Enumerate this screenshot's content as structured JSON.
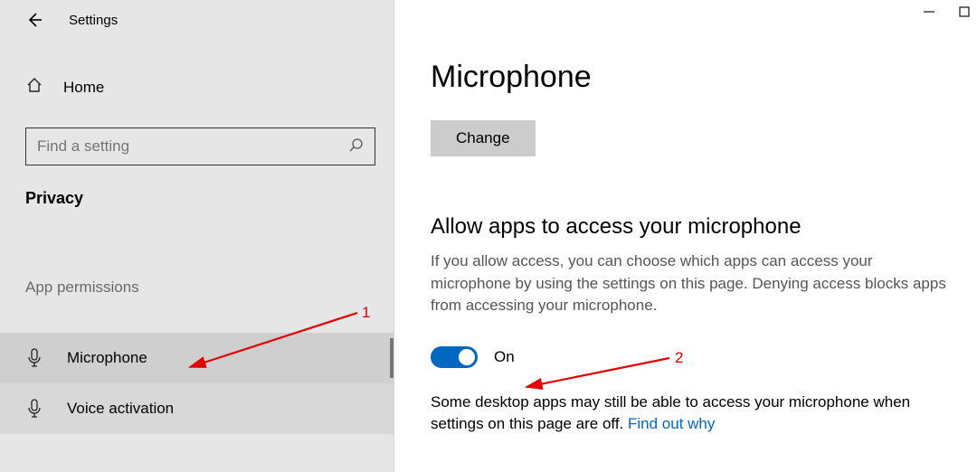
{
  "titlebar": {
    "title": "Settings"
  },
  "sidebar": {
    "home_label": "Home",
    "search_placeholder": "Find a setting",
    "category": "Privacy",
    "group_label": "App permissions",
    "items": [
      {
        "label": "Microphone"
      },
      {
        "label": "Voice activation"
      }
    ]
  },
  "main": {
    "page_title": "Microphone",
    "change_label": "Change",
    "section_title": "Allow apps to access your microphone",
    "section_desc": "If you allow access, you can choose which apps can access your microphone by using the settings on this page. Denying access blocks apps from accessing your microphone.",
    "toggle_state_label": "On",
    "footnote_text": "Some desktop apps may still be able to access your microphone when settings on this page are off. ",
    "footnote_link": "Find out why"
  },
  "annotations": {
    "a1": "1",
    "a2": "2"
  }
}
